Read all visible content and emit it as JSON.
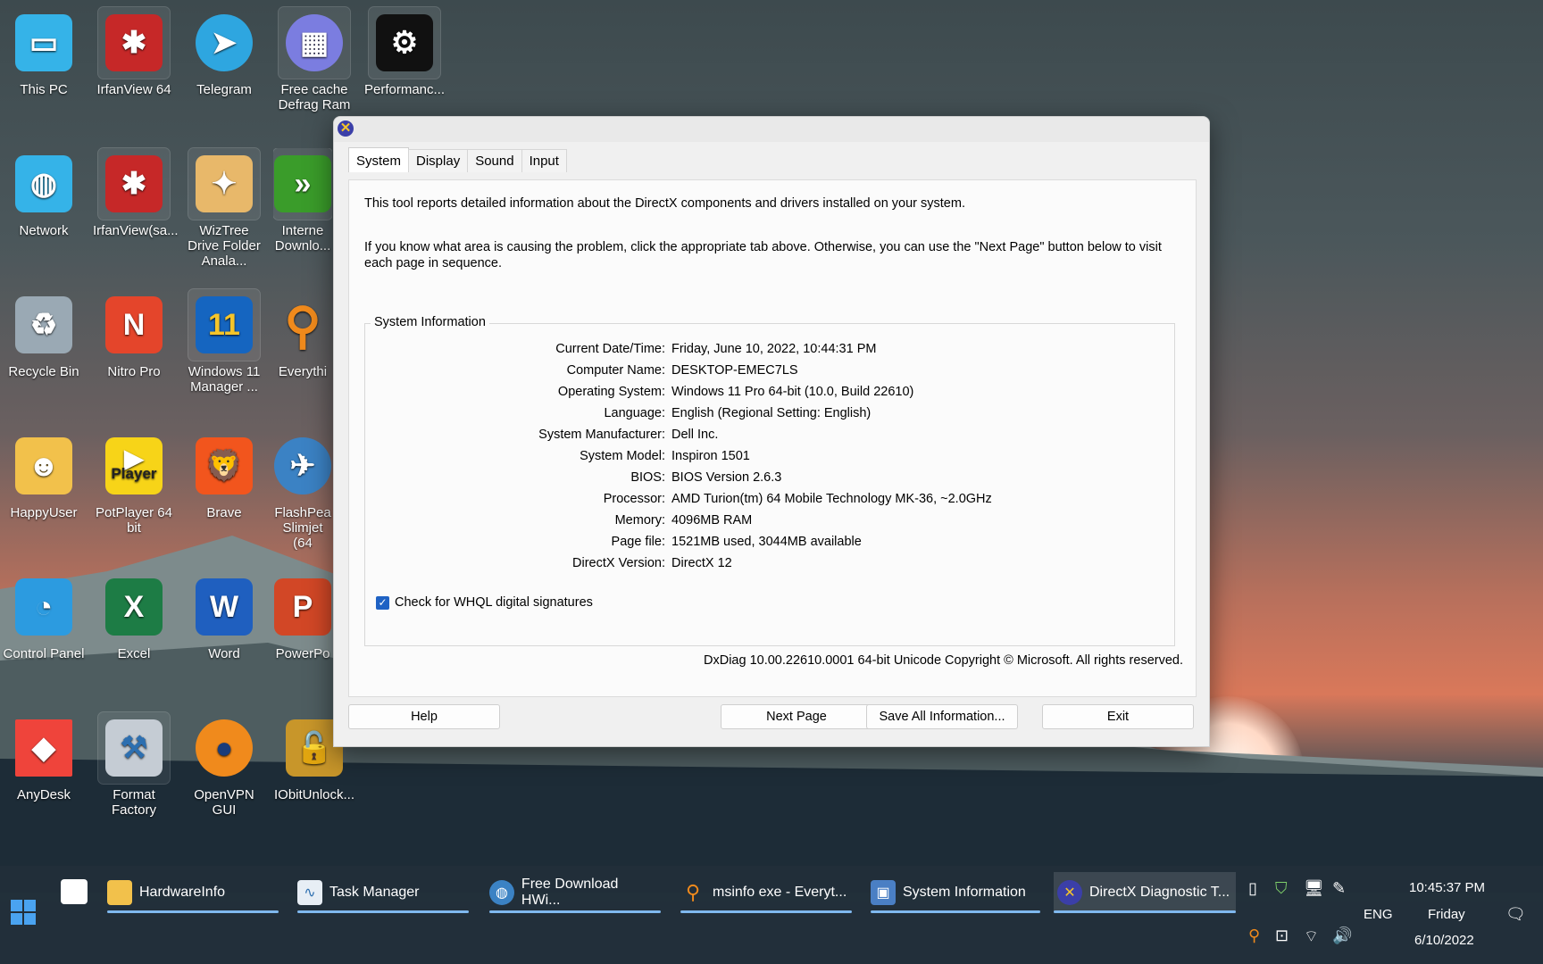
{
  "desktop": {
    "icons": [
      {
        "label": "This PC",
        "icon": "monitor-icon"
      },
      {
        "label": "IrfanView 64",
        "icon": "irfanview-icon"
      },
      {
        "label": "Telegram",
        "icon": "telegram-icon"
      },
      {
        "label": "Free cache Defrag Ram",
        "icon": "ram-chip-icon"
      },
      {
        "label": "Performanc...",
        "icon": "gauge-icon"
      },
      {
        "label": "Network",
        "icon": "network-globe-icon"
      },
      {
        "label": "IrfanView(sa...",
        "icon": "irfanview-icon"
      },
      {
        "label": "WizTree Drive Folder Anala...",
        "icon": "wiztree-icon"
      },
      {
        "label": "Interne Downlo...",
        "icon": "idm-icon"
      },
      {
        "label": "Recycle Bin",
        "icon": "recycle-bin-icon"
      },
      {
        "label": "Nitro Pro",
        "icon": "nitro-icon"
      },
      {
        "label": "Windows 11 Manager ...",
        "icon": "win11-manager-icon"
      },
      {
        "label": "Everythi",
        "icon": "search-magnifier-icon"
      },
      {
        "label": "HappyUser",
        "icon": "user-folder-icon"
      },
      {
        "label": "PotPlayer 64 bit",
        "icon": "potplayer-icon"
      },
      {
        "label": "Brave",
        "icon": "brave-lion-icon"
      },
      {
        "label": "FlashPea Slimjet (64",
        "icon": "slimjet-globe-icon"
      },
      {
        "label": "Control Panel",
        "icon": "control-panel-icon"
      },
      {
        "label": "Excel",
        "icon": "excel-icon"
      },
      {
        "label": "Word",
        "icon": "word-icon"
      },
      {
        "label": "PowerPo",
        "icon": "powerpoint-icon"
      },
      {
        "label": "AnyDesk",
        "icon": "anydesk-icon"
      },
      {
        "label": "Format Factory",
        "icon": "format-factory-icon"
      },
      {
        "label": "OpenVPN GUI",
        "icon": "openvpn-icon"
      },
      {
        "label": "IObitUnlock...",
        "icon": "iobit-unlocker-icon"
      }
    ],
    "player_text": "Player"
  },
  "dialog": {
    "tabs": [
      "System",
      "Display",
      "Sound",
      "Input"
    ],
    "intro": "This tool reports detailed information about the DirectX components and drivers installed on your system.",
    "intro2": "If you know what area is causing the problem, click the appropriate tab above.  Otherwise, you can use the \"Next Page\" button below to visit each page in sequence.",
    "group_title": "System Information",
    "rows": [
      {
        "label": "Current Date/Time:",
        "value": "Friday, June 10, 2022, 10:44:31 PM"
      },
      {
        "label": "Computer Name:",
        "value": "DESKTOP-EMEC7LS"
      },
      {
        "label": "Operating System:",
        "value": "Windows 11 Pro 64-bit (10.0, Build 22610)"
      },
      {
        "label": "Language:",
        "value": "English (Regional Setting: English)"
      },
      {
        "label": "System Manufacturer:",
        "value": "Dell Inc."
      },
      {
        "label": "System Model:",
        "value": "Inspiron 1501"
      },
      {
        "label": "BIOS:",
        "value": "BIOS Version 2.6.3"
      },
      {
        "label": "Processor:",
        "value": "AMD Turion(tm) 64 Mobile Technology MK-36, ~2.0GHz"
      },
      {
        "label": "Memory:",
        "value": "4096MB RAM"
      },
      {
        "label": "Page file:",
        "value": "1521MB used, 3044MB available"
      },
      {
        "label": "DirectX Version:",
        "value": "DirectX 12"
      }
    ],
    "whql_label": "Check for WHQL digital signatures",
    "whql_checked": true,
    "copyright": "DxDiag 10.00.22610.0001 64-bit Unicode  Copyright © Microsoft. All rights reserved.",
    "buttons": {
      "help": "Help",
      "next": "Next Page",
      "save": "Save All Information...",
      "exit": "Exit"
    }
  },
  "taskbar": {
    "items": [
      {
        "label": "HardwareInfo",
        "icon": "folder-icon"
      },
      {
        "label": "Task Manager",
        "icon": "task-manager-icon"
      },
      {
        "label": "Free Download HWi...",
        "icon": "browser-globe-icon"
      },
      {
        "label": "msinfo exe - Everyt...",
        "icon": "search-magnifier-icon"
      },
      {
        "label": "System Information",
        "icon": "system-info-icon"
      },
      {
        "label": "DirectX Diagnostic T...",
        "icon": "directx-icon"
      }
    ],
    "time": "10:45:37 PM",
    "day": "Friday",
    "date": "6/10/2022",
    "lang": "ENG"
  }
}
